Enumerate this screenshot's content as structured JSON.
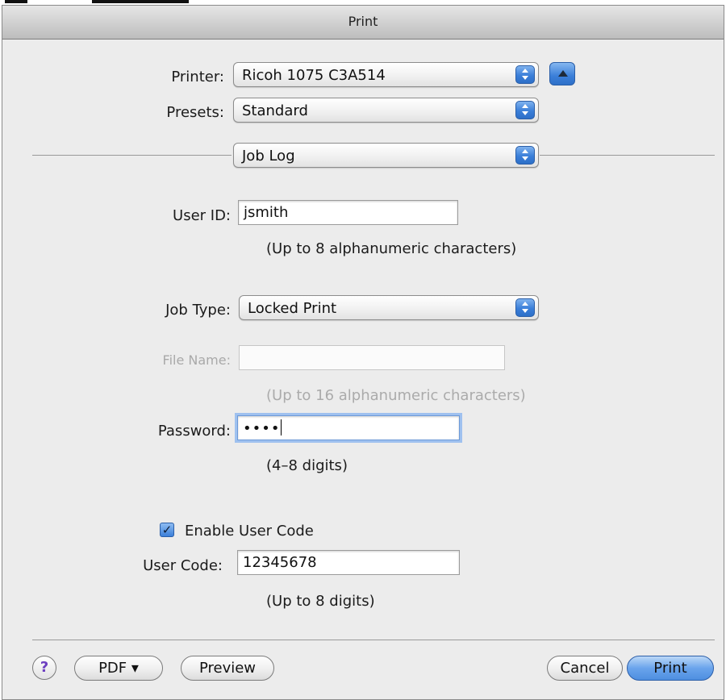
{
  "window": {
    "title": "Print"
  },
  "printer": {
    "label": "Printer:",
    "value": "Ricoh 1075 C3A514"
  },
  "presets": {
    "label": "Presets:",
    "value": "Standard"
  },
  "section": {
    "value": "Job Log"
  },
  "user_id": {
    "label": "User ID:",
    "value": "jsmith",
    "hint": "(Up to 8 alphanumeric characters)"
  },
  "job_type": {
    "label": "Job Type:",
    "value": "Locked Print"
  },
  "file_name": {
    "label": "File Name:",
    "value": "",
    "hint": "(Up to 16 alphanumeric characters)"
  },
  "password": {
    "label": "Password:",
    "value": "••••",
    "hint": "(4–8 digits)"
  },
  "enable_user_code": {
    "label": "Enable User Code",
    "checked": true
  },
  "user_code": {
    "label": "User Code:",
    "value": "12345678",
    "hint": "(Up to 8 digits)"
  },
  "footer": {
    "help": "?",
    "pdf": "PDF ▾",
    "preview": "Preview",
    "cancel": "Cancel",
    "print": "Print"
  },
  "icons": {
    "checkbox_mark": "✓",
    "disclosure": "up-triangle-icon",
    "popup_arrows": "up-down-arrows-icon"
  },
  "colors": {
    "accent": "#3b7fd9",
    "window_bg": "#ececec",
    "disabled_text": "#a9a9a9"
  }
}
